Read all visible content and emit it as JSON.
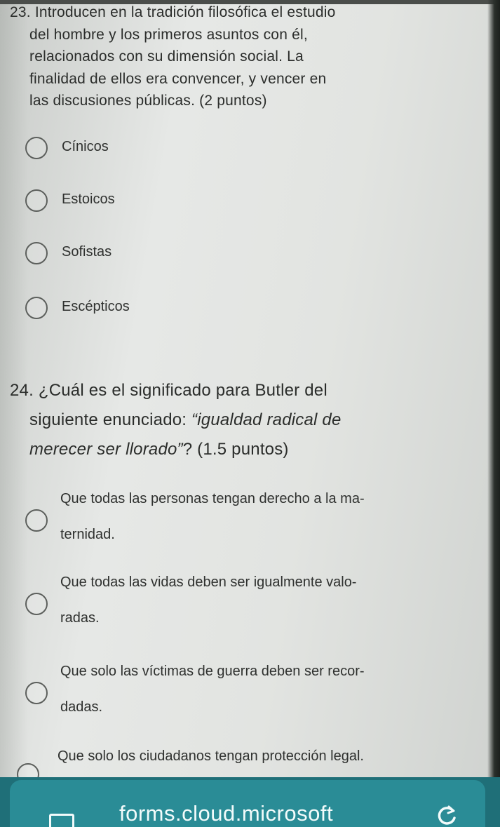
{
  "q23": {
    "text_lines": [
      "23. Introducen en la tradición filosófica el estudio",
      "del hombre y los primeros asuntos con él,",
      "relacionados con su dimensión social. La",
      "finalidad de ellos era convencer, y vencer en",
      "las discusiones públicas. (2 puntos)"
    ],
    "options": [
      "Cínicos",
      "Estoicos",
      "Sofistas",
      "Escépticos"
    ]
  },
  "q24": {
    "line1": "24. ¿Cuál es el significado para Butler del",
    "line2_start": "siguiente enunciado: ",
    "line2_italic": "“igualdad radical de",
    "line3_italic": "merecer ser llorado”",
    "line3_end": "? (1.5 puntos)",
    "options": [
      {
        "line1": "Que todas las personas tengan derecho a la ma-",
        "line2": "ternidad."
      },
      {
        "line1": "Que todas las vidas deben ser igualmente valo-",
        "line2": "radas."
      },
      {
        "line1": "Que solo las víctimas de guerra deben ser recor-",
        "line2": "dadas."
      },
      {
        "line1": "Que solo los ciudadanos tengan protección legal.",
        "line2": ""
      }
    ]
  },
  "footer": {
    "brand": "forms.cloud.microsoft",
    "icons": [
      "tabs-icon",
      "reload-icon"
    ]
  },
  "colors": {
    "footer_bar": "#1f6f78",
    "footer_card": "#2a8c96",
    "text": "#2b2d2b"
  }
}
